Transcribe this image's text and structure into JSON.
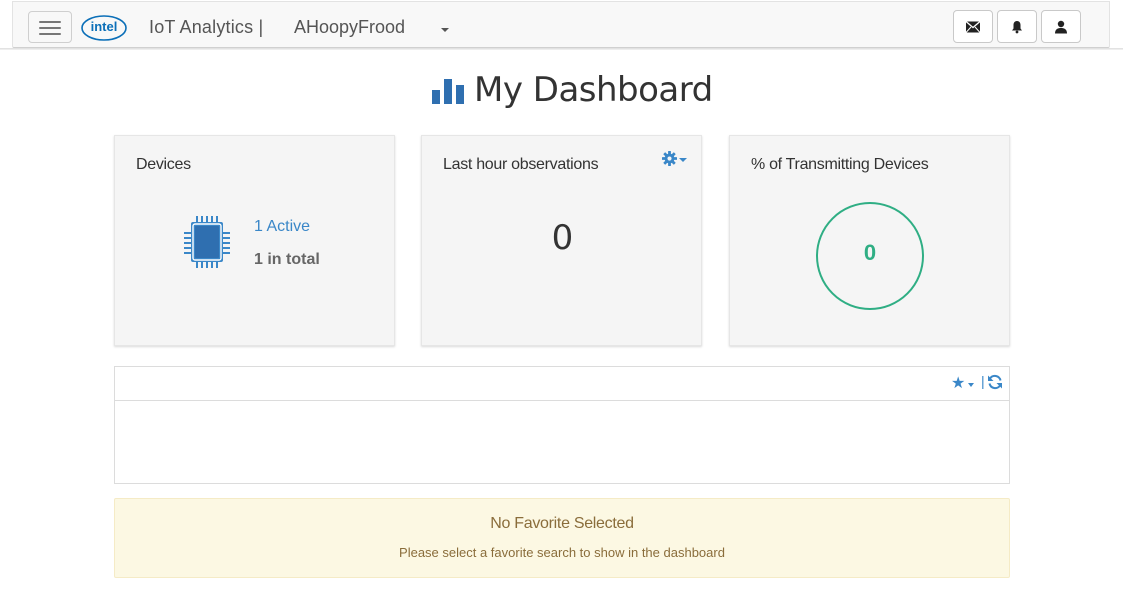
{
  "navbar": {
    "brand": "IoT Analytics |",
    "account": "AHoopyFrood",
    "logo_text": "intel",
    "icons": [
      "menu-icon",
      "envelope-icon",
      "bell-icon",
      "user-icon"
    ]
  },
  "page": {
    "title": "My Dashboard",
    "title_icon": "bar-chart-icon"
  },
  "cards": {
    "devices": {
      "title": "Devices",
      "active": "1 Active",
      "total": "1 in total",
      "icon": "chip-icon"
    },
    "observations": {
      "title": "Last hour observations",
      "value": "0",
      "icon": "gear-icon"
    },
    "transmitting": {
      "title": "% of Transmitting Devices",
      "value": "0"
    }
  },
  "favorites": {
    "toolbar_separator": "|",
    "icons": [
      "star-icon",
      "refresh-icon"
    ]
  },
  "alert": {
    "title": "No Favorite Selected",
    "message": "Please select a favorite search to show in the dashboard"
  },
  "colors": {
    "accent_blue": "#3a87c8",
    "success_green": "#2fae84",
    "alert_bg": "#fcf8e3",
    "alert_text": "#8a6d3b"
  }
}
